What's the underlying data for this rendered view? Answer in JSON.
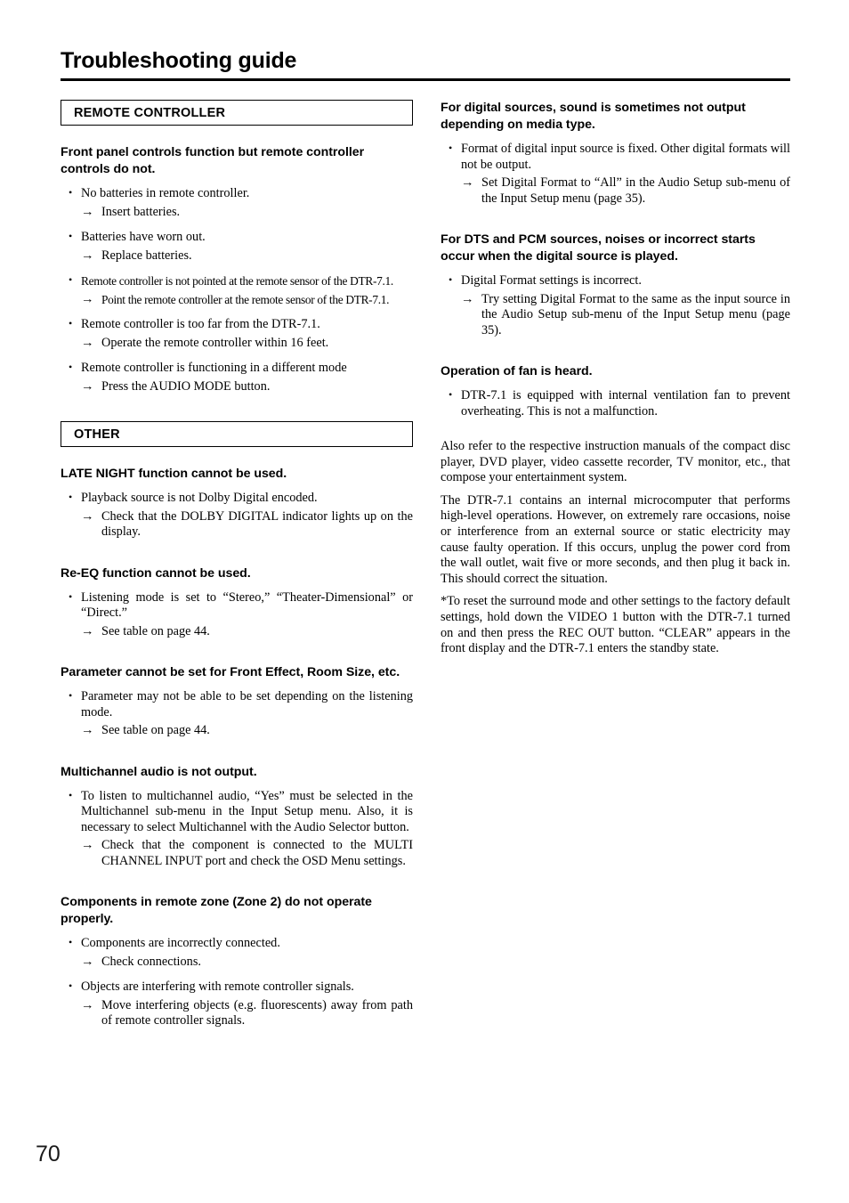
{
  "document": {
    "title": "Troubleshooting guide",
    "page_number": "70"
  },
  "left_column": {
    "section_remote": {
      "bar_label": "REMOTE CONTROLLER",
      "heading": "Front panel controls function but remote controller controls do not.",
      "items": [
        {
          "bullet": "No batteries in remote controller.",
          "arrow": "Insert batteries."
        },
        {
          "bullet": "Batteries have worn out.",
          "arrow": "Replace batteries."
        },
        {
          "bullet": "Remote controller is not pointed at the remote sensor of the DTR-7.1.",
          "arrow": "Point the remote controller at the remote sensor of the DTR-7.1."
        },
        {
          "bullet": "Remote controller is too far from the DTR-7.1.",
          "arrow": "Operate the remote controller within 16 feet."
        },
        {
          "bullet": "Remote controller is functioning in a different mode",
          "arrow": "Press the AUDIO MODE button."
        }
      ]
    },
    "section_other": {
      "bar_label": "OTHER",
      "blocks": [
        {
          "heading": "LATE NIGHT function cannot be used.",
          "bullet": "Playback source is not Dolby Digital encoded.",
          "arrow": "Check that the DOLBY DIGITAL indicator lights up on the display."
        },
        {
          "heading": "Re-EQ function cannot be used.",
          "bullet": "Listening mode is set to “Stereo,” “Theater-Dimensional” or “Direct.”",
          "arrow": "See table on page 44."
        },
        {
          "heading": "Parameter cannot be set for Front Effect, Room Size, etc.",
          "bullet": "Parameter may not be able to be set depending on the listening mode.",
          "arrow": "See table on page 44."
        },
        {
          "heading": "Multichannel audio is not output.",
          "bullet": "To listen to multichannel audio, “Yes” must be selected in the Multichannel sub-menu in the Input Setup menu. Also, it is necessary to select Multichannel with the Audio Selector button.",
          "arrow": "Check that the component is connected to the MULTI CHANNEL INPUT port and check the OSD Menu settings."
        }
      ],
      "zone2": {
        "heading": "Components in remote zone (Zone 2) do not operate properly.",
        "items": [
          {
            "bullet": "Components are incorrectly connected.",
            "arrow": "Check connections."
          },
          {
            "bullet": "Objects are interfering with remote controller signals.",
            "arrow": "Move interfering objects (e.g. fluorescents) away from path of remote controller signals."
          }
        ]
      }
    }
  },
  "right_column": {
    "blocks": [
      {
        "heading": "For digital sources, sound is sometimes not output depending on media type.",
        "bullet": "Format of digital input source is fixed. Other digital formats will not be output.",
        "arrow": "Set Digital Format to “All” in the Audio Setup sub-menu of the Input Setup menu (page 35)."
      },
      {
        "heading": "For DTS and PCM sources, noises or incorrect starts occur when the digital source is played.",
        "bullet": "Digital Format settings is incorrect.",
        "arrow": "Try setting Digital Format to the same as the input source in the Audio Setup sub-menu of the Input Setup menu (page 35)."
      },
      {
        "heading": "Operation of fan is heard.",
        "bullet": "DTR-7.1 is equipped with internal ventilation fan to prevent overheating. This is not a malfunction.",
        "arrow": ""
      }
    ],
    "paragraphs": [
      "Also refer to the respective instruction manuals of the compact disc player, DVD player, video cassette recorder, TV monitor, etc., that compose your entertainment system.",
      "The DTR-7.1 contains an internal microcomputer that performs high-level operations. However, on extremely rare occasions, noise or interference from an external source or static electricity may cause faulty operation. If this occurs, unplug the power cord from the wall outlet, wait five or more seconds, and then plug it back in. This should correct the situation.",
      "*To reset the surround mode and other settings to the factory default settings, hold down the VIDEO 1 button with the DTR-7.1 turned on and then press the REC OUT button. “CLEAR” appears in the front display and the DTR-7.1 enters the standby state."
    ]
  }
}
